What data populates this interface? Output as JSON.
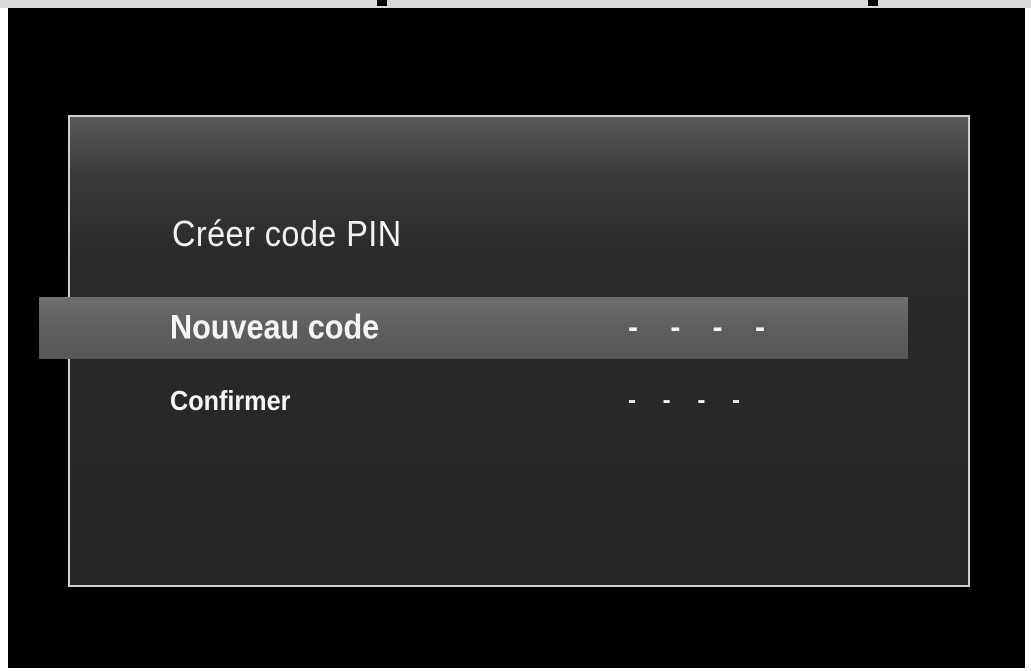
{
  "dialog": {
    "title": "Créer code PIN",
    "rows": [
      {
        "label": "Nouveau code",
        "value": "- - - -",
        "selected": true
      },
      {
        "label": "Confirmer",
        "value": "- - - -",
        "selected": false
      }
    ]
  },
  "colors": {
    "background": "#000000",
    "dialog_border": "#d0d0d0",
    "highlight": "#666666",
    "text": "#f5f5f5"
  }
}
